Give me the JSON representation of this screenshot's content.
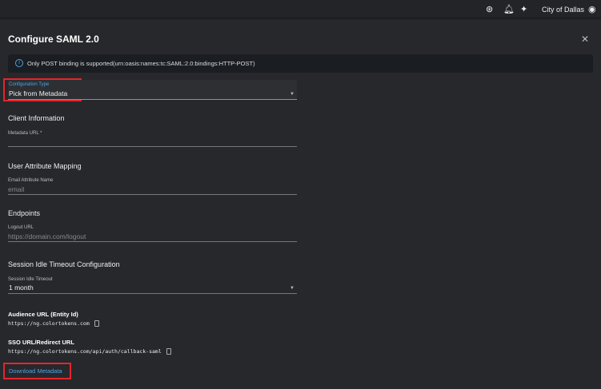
{
  "topbar": {
    "org_name": "City of Dallas",
    "icons": [
      "help-wheel-icon",
      "bell-icon",
      "sparkle-icon",
      "user-account-icon"
    ]
  },
  "dialog": {
    "title": "Configure SAML 2.0",
    "close_icon": "close-icon",
    "info": "Only POST binding is supported(urn:oasis:names:tc:SAML:2.0:bindings:HTTP-POST)",
    "config_type": {
      "label": "Configuration Type",
      "value": "Pick from Metadata"
    },
    "client_info": {
      "heading": "Client Information",
      "metadata_url_label": "Metadata URL *",
      "metadata_url_value": ""
    },
    "user_attr": {
      "heading": "User Attribute Mapping",
      "email_label": "Email Attribute Name",
      "email_placeholder": "email"
    },
    "endpoints": {
      "heading": "Endpoints",
      "logout_label": "Logout URL",
      "logout_placeholder": "https://domain.com/logout"
    },
    "session": {
      "heading": "Session Idle Timeout Configuration",
      "label": "Session Idle Timeout",
      "value": "1 month"
    },
    "audience": {
      "label": "Audience URL (Entity Id)",
      "value": "https://ng.colortokens.com"
    },
    "sso": {
      "label": "SSO URL/Redirect URL",
      "value": "https://ng.colortokens.com/api/auth/callback-saml"
    },
    "download_label": "Download Metadata"
  },
  "colors": {
    "accent": "#4ea3e6",
    "highlight": "#e3262b",
    "background": "#26282c"
  }
}
